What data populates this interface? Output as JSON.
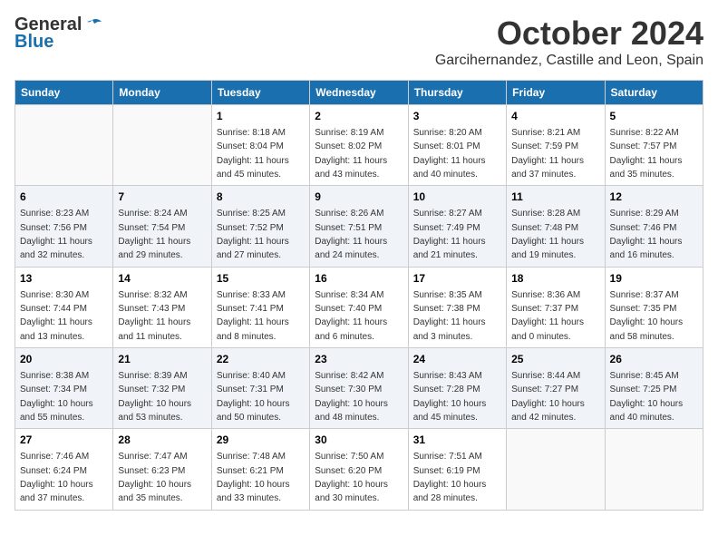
{
  "header": {
    "logo_line1": "General",
    "logo_line2": "Blue",
    "month_title": "October 2024",
    "location": "Garcihernandez, Castille and Leon, Spain"
  },
  "weekdays": [
    "Sunday",
    "Monday",
    "Tuesday",
    "Wednesday",
    "Thursday",
    "Friday",
    "Saturday"
  ],
  "weeks": [
    [
      {
        "day": "",
        "sunrise": "",
        "sunset": "",
        "daylight": ""
      },
      {
        "day": "",
        "sunrise": "",
        "sunset": "",
        "daylight": ""
      },
      {
        "day": "1",
        "sunrise": "Sunrise: 8:18 AM",
        "sunset": "Sunset: 8:04 PM",
        "daylight": "Daylight: 11 hours and 45 minutes."
      },
      {
        "day": "2",
        "sunrise": "Sunrise: 8:19 AM",
        "sunset": "Sunset: 8:02 PM",
        "daylight": "Daylight: 11 hours and 43 minutes."
      },
      {
        "day": "3",
        "sunrise": "Sunrise: 8:20 AM",
        "sunset": "Sunset: 8:01 PM",
        "daylight": "Daylight: 11 hours and 40 minutes."
      },
      {
        "day": "4",
        "sunrise": "Sunrise: 8:21 AM",
        "sunset": "Sunset: 7:59 PM",
        "daylight": "Daylight: 11 hours and 37 minutes."
      },
      {
        "day": "5",
        "sunrise": "Sunrise: 8:22 AM",
        "sunset": "Sunset: 7:57 PM",
        "daylight": "Daylight: 11 hours and 35 minutes."
      }
    ],
    [
      {
        "day": "6",
        "sunrise": "Sunrise: 8:23 AM",
        "sunset": "Sunset: 7:56 PM",
        "daylight": "Daylight: 11 hours and 32 minutes."
      },
      {
        "day": "7",
        "sunrise": "Sunrise: 8:24 AM",
        "sunset": "Sunset: 7:54 PM",
        "daylight": "Daylight: 11 hours and 29 minutes."
      },
      {
        "day": "8",
        "sunrise": "Sunrise: 8:25 AM",
        "sunset": "Sunset: 7:52 PM",
        "daylight": "Daylight: 11 hours and 27 minutes."
      },
      {
        "day": "9",
        "sunrise": "Sunrise: 8:26 AM",
        "sunset": "Sunset: 7:51 PM",
        "daylight": "Daylight: 11 hours and 24 minutes."
      },
      {
        "day": "10",
        "sunrise": "Sunrise: 8:27 AM",
        "sunset": "Sunset: 7:49 PM",
        "daylight": "Daylight: 11 hours and 21 minutes."
      },
      {
        "day": "11",
        "sunrise": "Sunrise: 8:28 AM",
        "sunset": "Sunset: 7:48 PM",
        "daylight": "Daylight: 11 hours and 19 minutes."
      },
      {
        "day": "12",
        "sunrise": "Sunrise: 8:29 AM",
        "sunset": "Sunset: 7:46 PM",
        "daylight": "Daylight: 11 hours and 16 minutes."
      }
    ],
    [
      {
        "day": "13",
        "sunrise": "Sunrise: 8:30 AM",
        "sunset": "Sunset: 7:44 PM",
        "daylight": "Daylight: 11 hours and 13 minutes."
      },
      {
        "day": "14",
        "sunrise": "Sunrise: 8:32 AM",
        "sunset": "Sunset: 7:43 PM",
        "daylight": "Daylight: 11 hours and 11 minutes."
      },
      {
        "day": "15",
        "sunrise": "Sunrise: 8:33 AM",
        "sunset": "Sunset: 7:41 PM",
        "daylight": "Daylight: 11 hours and 8 minutes."
      },
      {
        "day": "16",
        "sunrise": "Sunrise: 8:34 AM",
        "sunset": "Sunset: 7:40 PM",
        "daylight": "Daylight: 11 hours and 6 minutes."
      },
      {
        "day": "17",
        "sunrise": "Sunrise: 8:35 AM",
        "sunset": "Sunset: 7:38 PM",
        "daylight": "Daylight: 11 hours and 3 minutes."
      },
      {
        "day": "18",
        "sunrise": "Sunrise: 8:36 AM",
        "sunset": "Sunset: 7:37 PM",
        "daylight": "Daylight: 11 hours and 0 minutes."
      },
      {
        "day": "19",
        "sunrise": "Sunrise: 8:37 AM",
        "sunset": "Sunset: 7:35 PM",
        "daylight": "Daylight: 10 hours and 58 minutes."
      }
    ],
    [
      {
        "day": "20",
        "sunrise": "Sunrise: 8:38 AM",
        "sunset": "Sunset: 7:34 PM",
        "daylight": "Daylight: 10 hours and 55 minutes."
      },
      {
        "day": "21",
        "sunrise": "Sunrise: 8:39 AM",
        "sunset": "Sunset: 7:32 PM",
        "daylight": "Daylight: 10 hours and 53 minutes."
      },
      {
        "day": "22",
        "sunrise": "Sunrise: 8:40 AM",
        "sunset": "Sunset: 7:31 PM",
        "daylight": "Daylight: 10 hours and 50 minutes."
      },
      {
        "day": "23",
        "sunrise": "Sunrise: 8:42 AM",
        "sunset": "Sunset: 7:30 PM",
        "daylight": "Daylight: 10 hours and 48 minutes."
      },
      {
        "day": "24",
        "sunrise": "Sunrise: 8:43 AM",
        "sunset": "Sunset: 7:28 PM",
        "daylight": "Daylight: 10 hours and 45 minutes."
      },
      {
        "day": "25",
        "sunrise": "Sunrise: 8:44 AM",
        "sunset": "Sunset: 7:27 PM",
        "daylight": "Daylight: 10 hours and 42 minutes."
      },
      {
        "day": "26",
        "sunrise": "Sunrise: 8:45 AM",
        "sunset": "Sunset: 7:25 PM",
        "daylight": "Daylight: 10 hours and 40 minutes."
      }
    ],
    [
      {
        "day": "27",
        "sunrise": "Sunrise: 7:46 AM",
        "sunset": "Sunset: 6:24 PM",
        "daylight": "Daylight: 10 hours and 37 minutes."
      },
      {
        "day": "28",
        "sunrise": "Sunrise: 7:47 AM",
        "sunset": "Sunset: 6:23 PM",
        "daylight": "Daylight: 10 hours and 35 minutes."
      },
      {
        "day": "29",
        "sunrise": "Sunrise: 7:48 AM",
        "sunset": "Sunset: 6:21 PM",
        "daylight": "Daylight: 10 hours and 33 minutes."
      },
      {
        "day": "30",
        "sunrise": "Sunrise: 7:50 AM",
        "sunset": "Sunset: 6:20 PM",
        "daylight": "Daylight: 10 hours and 30 minutes."
      },
      {
        "day": "31",
        "sunrise": "Sunrise: 7:51 AM",
        "sunset": "Sunset: 6:19 PM",
        "daylight": "Daylight: 10 hours and 28 minutes."
      },
      {
        "day": "",
        "sunrise": "",
        "sunset": "",
        "daylight": ""
      },
      {
        "day": "",
        "sunrise": "",
        "sunset": "",
        "daylight": ""
      }
    ]
  ]
}
